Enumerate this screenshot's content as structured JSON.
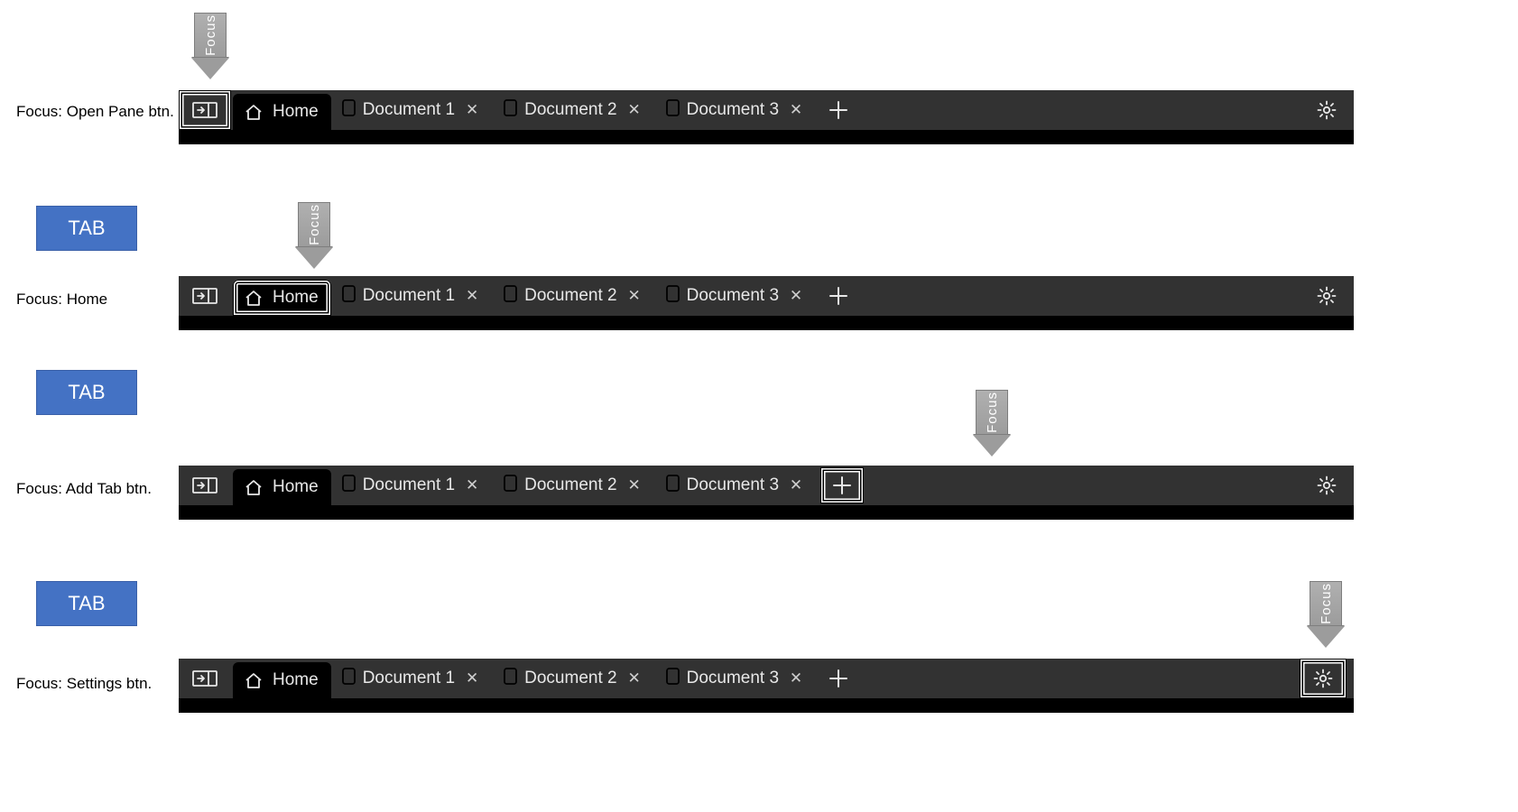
{
  "arrow_label": "Focus",
  "key_label": "TAB",
  "states": [
    {
      "caption": "Focus: Open Pane btn.",
      "focus": "open-pane"
    },
    {
      "caption": "Focus: Home",
      "focus": "home"
    },
    {
      "caption": "Focus: Add Tab btn.",
      "focus": "add"
    },
    {
      "caption": "Focus: Settings btn.",
      "focus": "settings"
    }
  ],
  "tabs": {
    "home": "Home",
    "docs": [
      "Document 1",
      "Document 2",
      "Document 3"
    ]
  },
  "icons": {
    "open_pane": "open-pane-icon",
    "home": "home-icon",
    "doc": "document-icon",
    "close": "close-icon",
    "add": "plus-icon",
    "settings": "gear-icon"
  }
}
